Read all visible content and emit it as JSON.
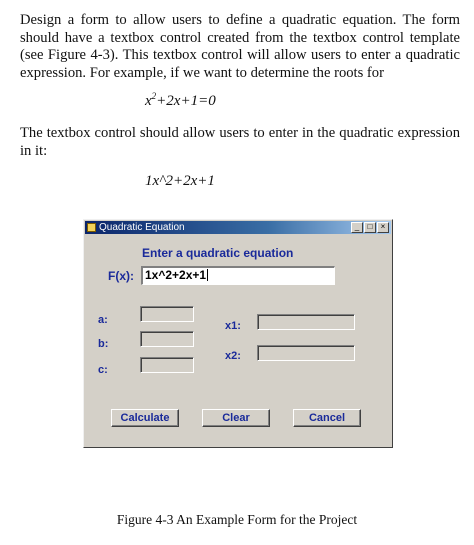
{
  "paragraph1": "Design a form to allow users to define a quadratic equation. The form should have a textbox control created from the textbox control template (see Figure 4-3). This textbox control will allow users to enter a quadratic expression. For example, if we want to determine the roots for",
  "equation1": {
    "base": "x",
    "exp": "2",
    "rest": "+2x+1=0"
  },
  "paragraph2": "The textbox control should allow users to enter in the quadratic expression in it:",
  "equation2": "1x^2+2x+1",
  "window": {
    "title": "Quadratic Equation",
    "controls": [
      "_",
      "□",
      "×"
    ],
    "heading": "Enter a quadratic equation",
    "fx_label": "F(x):",
    "fx_value": "1x^2+2x+1",
    "labels": {
      "a": "a:",
      "b": "b:",
      "c": "c:",
      "x1": "x1:",
      "x2": "x2:"
    },
    "buttons": {
      "calculate": "Calculate",
      "clear": "Clear",
      "cancel": "Cancel"
    }
  },
  "caption": "Figure 4-3 An Example Form for the Project"
}
